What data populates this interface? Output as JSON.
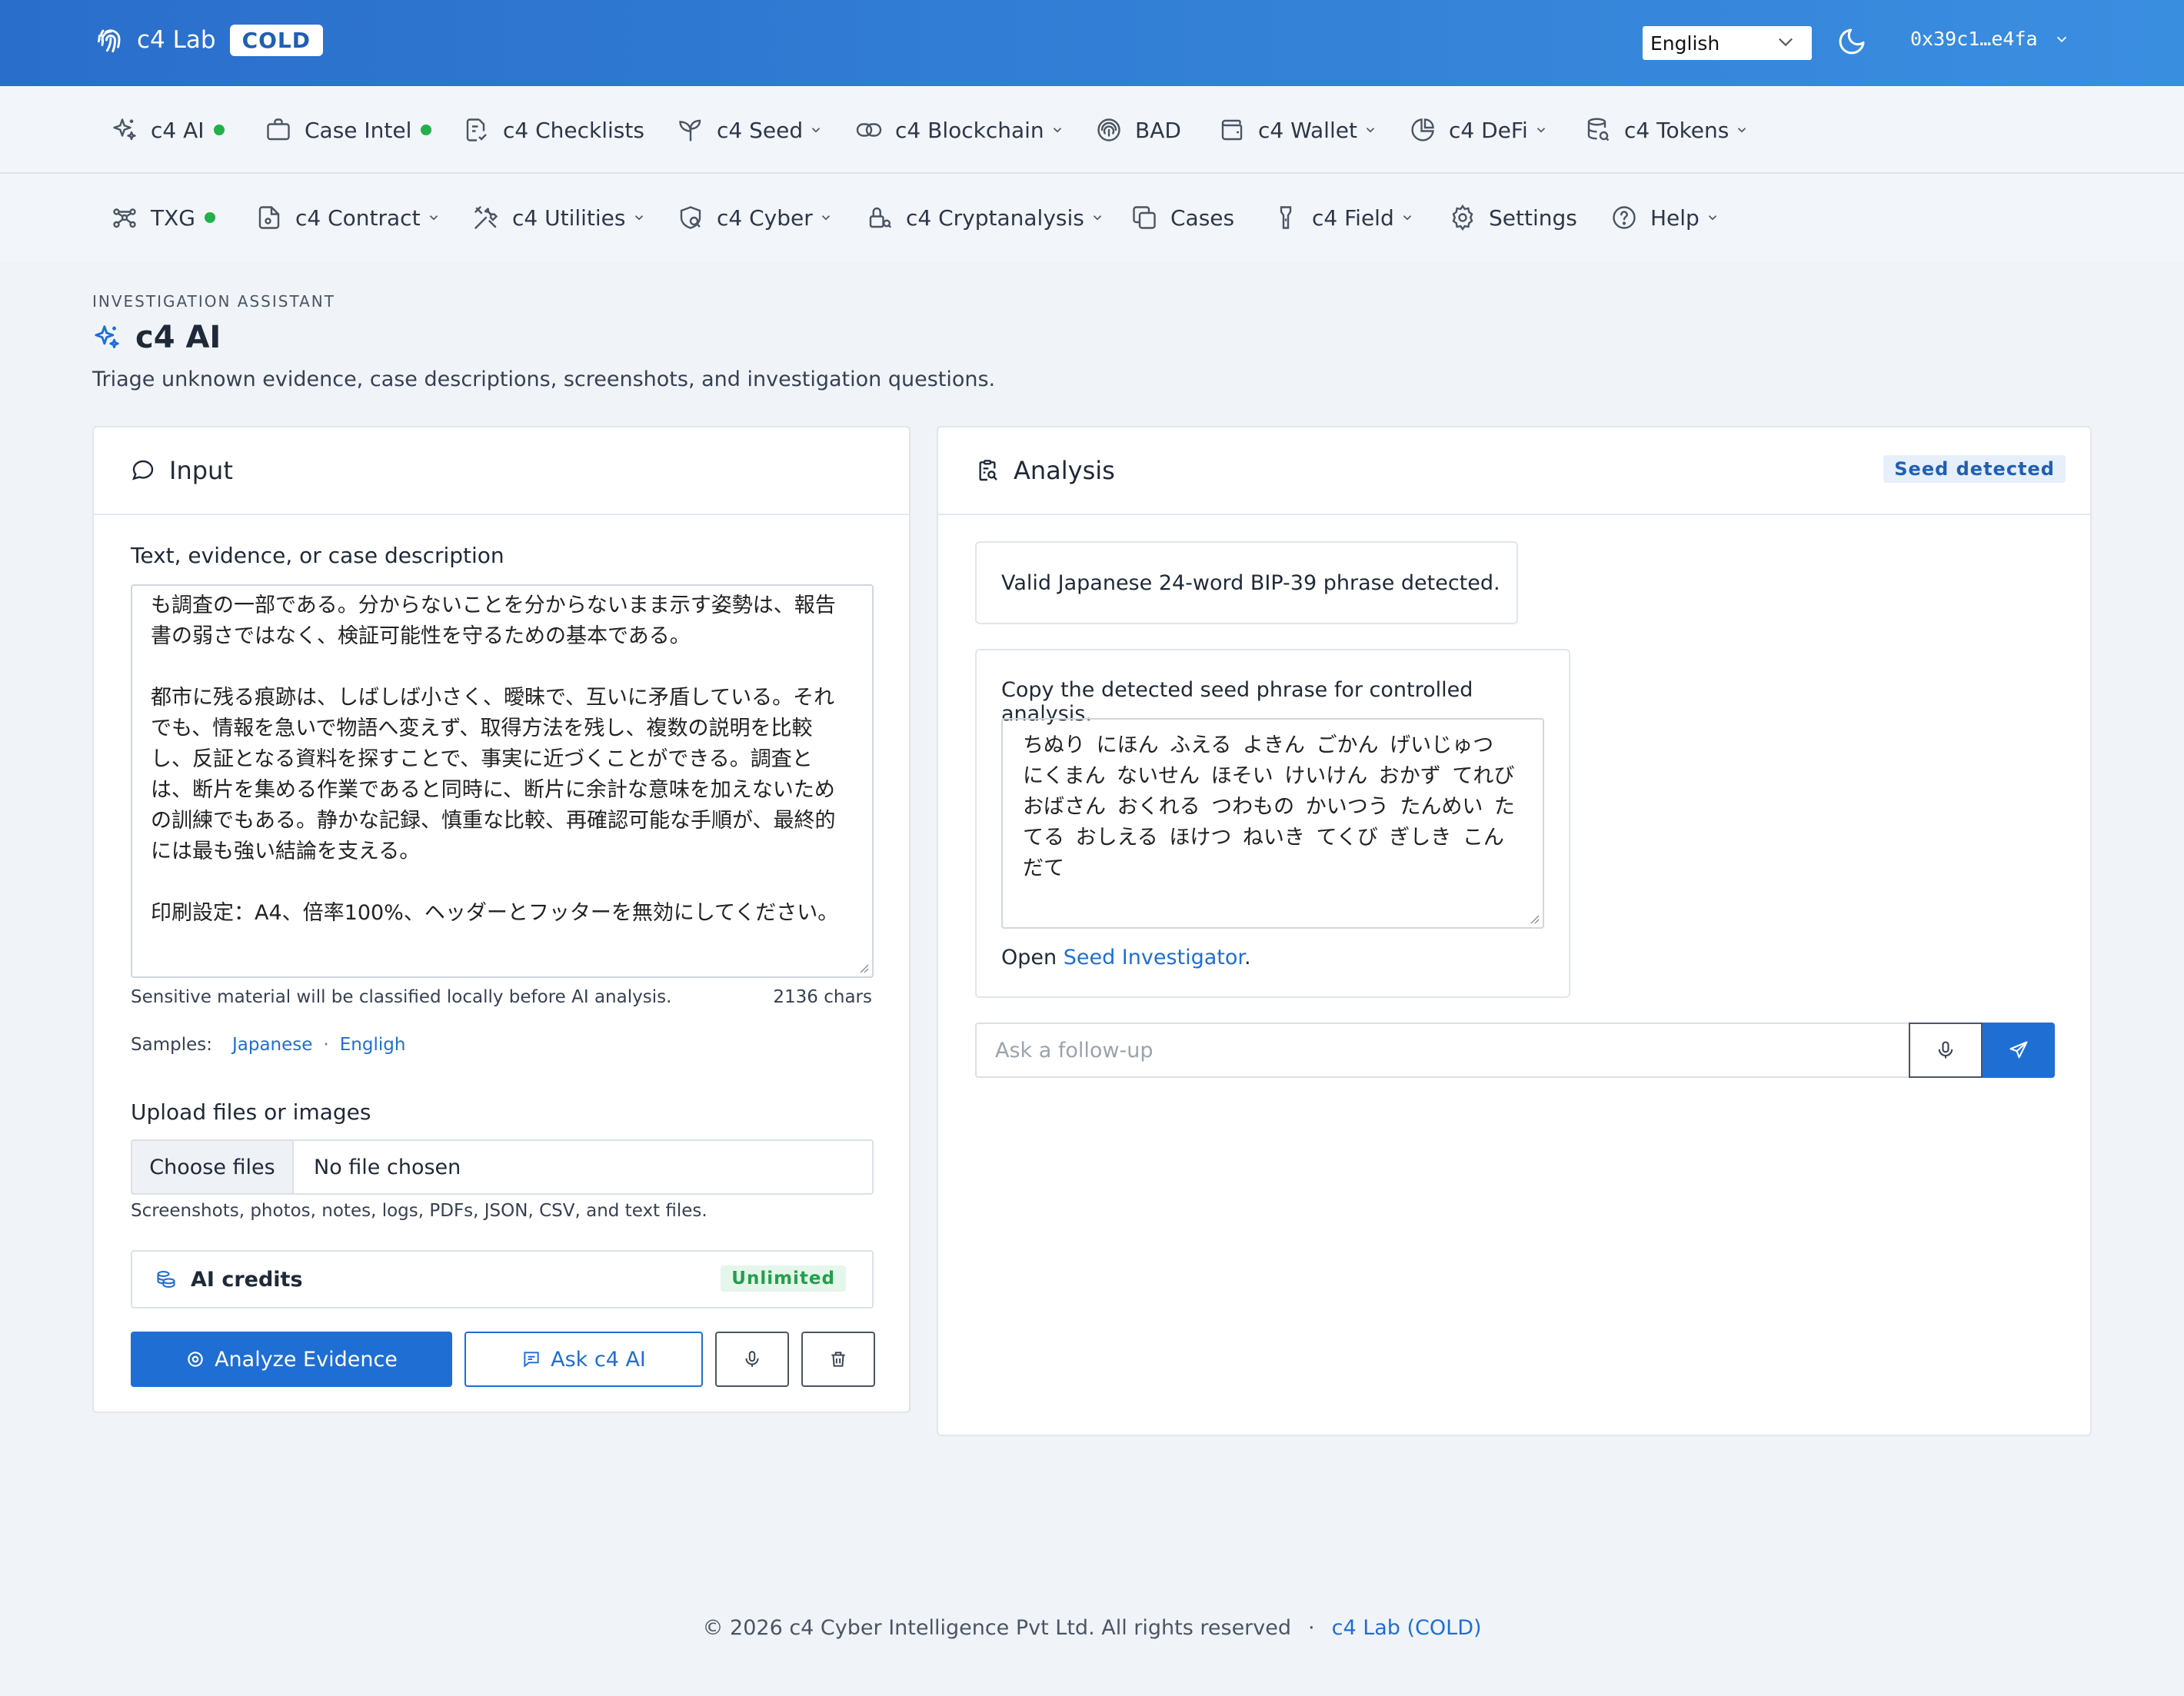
{
  "app": {
    "brand_name": "c4 Lab",
    "brand_badge": "COLD",
    "language": "English",
    "wallet": "0x39c1…e4fa"
  },
  "nav_row_1": [
    {
      "label": "c4 AI",
      "icon": "sparkle-icon",
      "dot": true
    },
    {
      "label": "Case Intel",
      "icon": "briefcase-icon",
      "dot": true
    },
    {
      "label": "c4 Checklists",
      "icon": "checklist-icon"
    },
    {
      "label": "c4 Seed",
      "icon": "sprout-icon",
      "menu": true
    },
    {
      "label": "c4 Blockchain",
      "icon": "link-icon",
      "menu": true
    },
    {
      "label": "BAD",
      "icon": "fingerprint-icon"
    },
    {
      "label": "c4 Wallet",
      "icon": "wallet-icon",
      "menu": true
    },
    {
      "label": "c4 DeFi",
      "icon": "pie-chart-icon",
      "menu": true
    },
    {
      "label": "c4 Tokens",
      "icon": "database-search-icon",
      "menu": true
    }
  ],
  "nav_row_2": [
    {
      "label": "TXG",
      "icon": "graph-icon",
      "dot": true
    },
    {
      "label": "c4 Contract",
      "icon": "file-code-icon",
      "menu": true
    },
    {
      "label": "c4 Utilities",
      "icon": "tools-icon",
      "menu": true
    },
    {
      "label": "c4 Cyber",
      "icon": "shield-search-icon",
      "menu": true
    },
    {
      "label": "c4 Cryptanalysis",
      "icon": "lock-search-icon",
      "menu": true
    },
    {
      "label": "Cases",
      "icon": "copy-icon"
    },
    {
      "label": "c4 Field",
      "icon": "flashlight-icon",
      "menu": true
    },
    {
      "label": "Settings",
      "icon": "gear-icon"
    },
    {
      "label": "Help",
      "icon": "help-circle-icon",
      "menu": true
    }
  ],
  "page": {
    "eyebrow": "INVESTIGATION ASSISTANT",
    "title": "c4 AI",
    "subtitle": "Triage unknown evidence, case descriptions, screenshots, and investigation questions."
  },
  "input_panel": {
    "title": "Input",
    "text_label": "Text, evidence, or case description",
    "text_value": "なければならない。十分な根拠が得られない場合は、結論を保留することも調査の一部である。分からないことを分からないまま示す姿勢は、報告書の弱さではなく、検証可能性を守るための基本である。\n\n都市に残る痕跡は、しばしば小さく、曖昧で、互いに矛盾している。それでも、情報を急いで物語へ変えず、取得方法を残し、複数の説明を比較し、反証となる資料を探すことで、事実に近づくことができる。調査とは、断片を集める作業であると同時に、断片に余計な意味を加えないための訓練でもある。静かな記録、慎重な比較、再確認可能な手順が、最終的には最も強い結論を支える。\n\n印刷設定：A4、倍率100%、ヘッダーとフッターを無効にしてください。",
    "sensitive_note": "Sensitive material will be classified locally before AI analysis.",
    "char_count": "2136 chars",
    "samples_label": "Samples:",
    "sample_japanese": "Japanese",
    "sample_separator": "·",
    "sample_english": "Engligh",
    "upload_label": "Upload files or images",
    "choose_files": "Choose files",
    "no_file": "No file chosen",
    "upload_help": "Screenshots, photos, notes, logs, PDFs, JSON, CSV, and text files.",
    "credits_label": "AI credits",
    "credits_badge": "Unlimited",
    "analyze_button": "Analyze Evidence",
    "ask_button": "Ask c4 AI"
  },
  "analysis_panel": {
    "title": "Analysis",
    "badge": "Seed detected",
    "result": "Valid Japanese 24-word BIP-39 phrase detected.",
    "copy_title": "Copy the detected seed phrase for controlled analysis.",
    "seed_phrase": "ちぬり にほん ふえる よきん ごかん げいじゅつ にくまん ないせん ほそい けいけん おかず てれび おばさん おくれる つわもの かいつう たんめい たてる おしえる ほけつ ねいき てくび ぎしき こんだて",
    "open_prefix": "Open",
    "open_link": "Seed Investigator",
    "open_suffix": ".",
    "followup_placeholder": "Ask a follow-up"
  },
  "footer": {
    "copyright": "© 2026 c4 Cyber Intelligence Pvt Ltd. All rights reserved",
    "separator": "·",
    "link": "c4 Lab (COLD)"
  },
  "colors": {
    "accent": "#1f6ed4",
    "status_green": "#22b04b",
    "topbar_start": "#2a6ecb",
    "topbar_end": "#3a8ee0"
  }
}
